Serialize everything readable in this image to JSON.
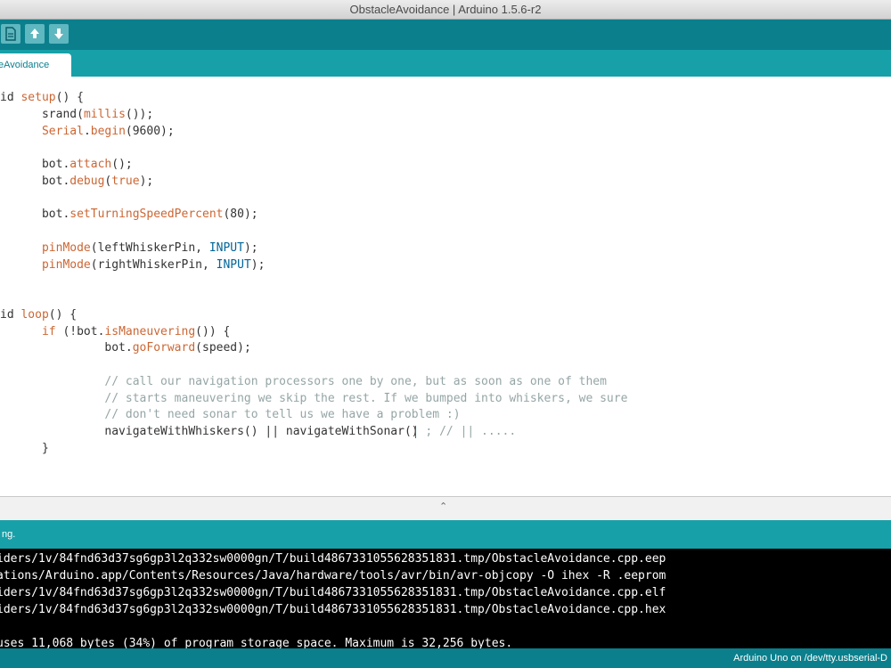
{
  "window": {
    "title": "ObstacleAvoidance | Arduino 1.5.6-r2"
  },
  "toolbar": {
    "buttons": [
      {
        "name": "new-icon"
      },
      {
        "name": "open-icon"
      },
      {
        "name": "save-icon"
      }
    ],
    "colors": {
      "bar": "#0b7f8c",
      "button": "#5fb7bf"
    }
  },
  "tabs": [
    {
      "label": "eAvoidance",
      "active": true
    }
  ],
  "code": {
    "l1": {
      "a": "id ",
      "b": "setup",
      "c": "() {"
    },
    "l2": {
      "a": "      ",
      "b": "srand",
      "c": "(",
      "d": "millis",
      "e": "());"
    },
    "l3": {
      "a": "      ",
      "b": "Serial",
      "c": ".",
      "d": "begin",
      "e": "(9600);"
    },
    "l5": {
      "a": "      bot.",
      "b": "attach",
      "c": "();"
    },
    "l6": {
      "a": "      bot.",
      "b": "debug",
      "c": "(",
      "d": "true",
      "e": ");"
    },
    "l8": {
      "a": "      bot.",
      "b": "setTurningSpeedPercent",
      "c": "(80);"
    },
    "l10": {
      "a": "      ",
      "b": "pinMode",
      "c": "(leftWhiskerPin, ",
      "d": "INPUT",
      "e": ");"
    },
    "l11": {
      "a": "      ",
      "b": "pinMode",
      "c": "(rightWhiskerPin, ",
      "d": "INPUT",
      "e": ");"
    },
    "l14": {
      "a": "id ",
      "b": "loop",
      "c": "() {"
    },
    "l15": {
      "a": "      ",
      "b": "if",
      "c": " (!bot.",
      "d": "isManeuvering",
      "e": "()) {"
    },
    "l16": {
      "a": "               bot.",
      "b": "goForward",
      "c": "(speed);"
    },
    "l18": {
      "a": "               // call our navigation processors one by one, but as soon as one of them"
    },
    "l19": {
      "a": "               // starts maneuvering we skip the rest. If we bumped into whiskers, we sure"
    },
    "l20": {
      "a": "               // don't need sonar to tell us we have a problem :)"
    },
    "l21": {
      "a": "               navigateWithWhiskers() || navigateWithSonar()",
      "b": " ; // || ....."
    },
    "l22": {
      "a": "      }"
    }
  },
  "status": {
    "message": "ng."
  },
  "console": {
    "lines": [
      "iders/1v/84fnd63d37sg6gp3l2q332sw0000gn/T/build4867331055628351831.tmp/ObstacleAvoidance.cpp.eep",
      "ations/Arduino.app/Contents/Resources/Java/hardware/tools/avr/bin/avr-objcopy -O ihex -R .eeprom",
      "iders/1v/84fnd63d37sg6gp3l2q332sw0000gn/T/build4867331055628351831.tmp/ObstacleAvoidance.cpp.elf",
      "iders/1v/84fnd63d37sg6gp3l2q332sw0000gn/T/build4867331055628351831.tmp/ObstacleAvoidance.cpp.hex",
      "",
      "uses 11,068 bytes (34%) of program storage space. Maximum is 32,256 bytes."
    ]
  },
  "footer": {
    "board": "Arduino Uno on /dev/tty.usbserial-D"
  },
  "colors": {
    "teal_dark": "#0b7f8c",
    "teal_light": "#18a0a8",
    "keyword": "#cc6633",
    "constant": "#006699",
    "comment": "#95a5a6"
  }
}
